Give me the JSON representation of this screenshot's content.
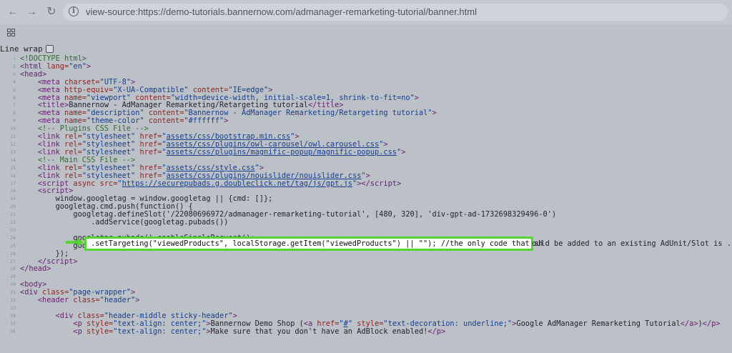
{
  "browser": {
    "url": "view-source:https://demo-tutorials.bannernow.com/admanager-remarketing-tutorial/banner.html",
    "back_icon": "arrow-left-icon",
    "forward_icon": "arrow-right-icon",
    "reload_icon": "reload-icon",
    "info_icon": "info-icon",
    "apps_icon": "grid-icon"
  },
  "viewer": {
    "line_wrap_label": "Line wrap",
    "line_wrap_checked": false
  },
  "source": {
    "lines": [
      {
        "n": "1",
        "html": "<span class=\"cmt\">&lt;!DOCTYPE html&gt;</span>"
      },
      {
        "n": "2",
        "html": "<span class=\"tag\">&lt;html</span> <span class=\"attr\">lang=</span><span class=\"val\">\"en\"</span><span class=\"tag\">&gt;</span>"
      },
      {
        "n": "3",
        "html": "<span class=\"tag\">&lt;head&gt;</span>"
      },
      {
        "n": "4",
        "html": "    <span class=\"tag\">&lt;meta</span> <span class=\"attr\">charset=</span><span class=\"val\">\"UTF-8\"</span><span class=\"tag\">&gt;</span>"
      },
      {
        "n": "5",
        "html": "    <span class=\"tag\">&lt;meta</span> <span class=\"attr\">http-equiv=</span><span class=\"val\">\"X-UA-Compatible\"</span> <span class=\"attr\">content=</span><span class=\"val\">\"IE=edge\"</span><span class=\"tag\">&gt;</span>"
      },
      {
        "n": "6",
        "html": "    <span class=\"tag\">&lt;meta</span> <span class=\"attr\">name=</span><span class=\"val\">\"viewport\"</span> <span class=\"attr\">content=</span><span class=\"val\">\"width=device-width, initial-scale=1, shrink-to-fit=no\"</span><span class=\"tag\">&gt;</span>"
      },
      {
        "n": "7",
        "html": "    <span class=\"tag\">&lt;title&gt;</span>Bannernow - AdManager Remarketing/Retargeting tutorial<span class=\"tag\">&lt;/title&gt;</span>"
      },
      {
        "n": "8",
        "html": "    <span class=\"tag\">&lt;meta</span> <span class=\"attr\">name=</span><span class=\"val\">\"description\"</span> <span class=\"attr\">content=</span><span class=\"val\">\"Bannernow - AdManager Remarketing/Retargeting tutorial\"</span><span class=\"tag\">&gt;</span>"
      },
      {
        "n": "9",
        "html": "    <span class=\"tag\">&lt;meta</span> <span class=\"attr\">name=</span><span class=\"val\">\"theme-color\"</span> <span class=\"attr\">content=</span><span class=\"val\">\"#ffffff\"</span><span class=\"tag\">&gt;</span>"
      },
      {
        "n": "10",
        "html": "    <span class=\"cmt\">&lt;!-- Plugins CSS File --&gt;</span>"
      },
      {
        "n": "11",
        "html": "    <span class=\"tag\">&lt;link</span> <span class=\"attr\">rel=</span><span class=\"val\">\"stylesheet\"</span> <span class=\"attr\">href=</span><span class=\"val\">\"<span class=\"link\">assets/css/bootstrap.min.css</span>\"</span><span class=\"tag\">&gt;</span>"
      },
      {
        "n": "12",
        "html": "    <span class=\"tag\">&lt;link</span> <span class=\"attr\">rel=</span><span class=\"val\">\"stylesheet\"</span> <span class=\"attr\">href=</span><span class=\"val\">\"<span class=\"link\">assets/css/plugins/owl-carousel/owl.carousel.css</span>\"</span><span class=\"tag\">&gt;</span>"
      },
      {
        "n": "13",
        "html": "    <span class=\"tag\">&lt;link</span> <span class=\"attr\">rel=</span><span class=\"val\">\"stylesheet\"</span> <span class=\"attr\">href=</span><span class=\"val\">\"<span class=\"link\">assets/css/plugins/magnific-popup/magnific-popup.css</span>\"</span><span class=\"tag\">&gt;</span>"
      },
      {
        "n": "14",
        "html": "    <span class=\"cmt\">&lt;!-- Main CSS File --&gt;</span>"
      },
      {
        "n": "15",
        "html": "    <span class=\"tag\">&lt;link</span> <span class=\"attr\">rel=</span><span class=\"val\">\"stylesheet\"</span> <span class=\"attr\">href=</span><span class=\"val\">\"<span class=\"link\">assets/css/style.css</span>\"</span><span class=\"tag\">&gt;</span>"
      },
      {
        "n": "16",
        "html": "    <span class=\"tag\">&lt;link</span> <span class=\"attr\">rel=</span><span class=\"val\">\"stylesheet\"</span> <span class=\"attr\">href=</span><span class=\"val\">\"<span class=\"link\">assets/css/plugins/nouislider/nouislider.css</span>\"</span><span class=\"tag\">&gt;</span>"
      },
      {
        "n": "17",
        "html": "    <span class=\"tag\">&lt;script</span> <span class=\"attr\">async src=</span><span class=\"val\">\"<span class=\"link\">https://securepubads.g.doubleclick.net/tag/js/gpt.js</span>\"</span><span class=\"tag\">&gt;&lt;/script&gt;</span>"
      },
      {
        "n": "18",
        "html": "    <span class=\"tag\">&lt;script&gt;</span>"
      },
      {
        "n": "19",
        "html": "        window.googletag = window.googletag || {cmd: []};"
      },
      {
        "n": "20",
        "html": "        googletag.cmd.push(function() {"
      },
      {
        "n": "21",
        "html": "            googletag.defineSlot('/22080696972/admanager-remarketing-tutorial', [480, 320], 'div-gpt-ad-1732698329496-0')"
      },
      {
        "n": "22",
        "html": "                .addService(googletag.pubads())"
      },
      {
        "n": "23",
        "html": ""
      },
      {
        "n": "24",
        "html": "            googletag.pubads().enableSingleRequest();"
      },
      {
        "n": "25",
        "html": "            googletag.enableServices();"
      },
      {
        "n": "26",
        "html": "        });"
      },
      {
        "n": "27",
        "html": "    <span class=\"tag\">&lt;/script&gt;</span>"
      },
      {
        "n": "28",
        "html": "<span class=\"tag\">&lt;/head&gt;</span>"
      },
      {
        "n": "29",
        "html": ""
      },
      {
        "n": "30",
        "html": "<span class=\"tag\">&lt;body&gt;</span>"
      },
      {
        "n": "31",
        "html": "<span class=\"tag\">&lt;div</span> <span class=\"attr\">class=</span><span class=\"val\">\"page-wrapper\"</span><span class=\"tag\">&gt;</span>"
      },
      {
        "n": "32",
        "html": "    <span class=\"tag\">&lt;header</span> <span class=\"attr\">class=</span><span class=\"val\">\"header\"</span><span class=\"tag\">&gt;</span>"
      },
      {
        "n": "33",
        "html": ""
      },
      {
        "n": "34",
        "html": "        <span class=\"tag\">&lt;div</span> <span class=\"attr\">class=</span><span class=\"val\">\"header-middle sticky-header\"</span><span class=\"tag\">&gt;</span>"
      },
      {
        "n": "35",
        "html": "            <span class=\"tag\">&lt;p</span> <span class=\"attr\">style=</span><span class=\"val\">\"text-align: center;\"</span><span class=\"tag\">&gt;</span>Bannernow Demo Shop (<span class=\"tag\">&lt;a</span> <span class=\"attr\">href=</span><span class=\"val\">\"<span class=\"link\">#</span>\"</span> <span class=\"attr\">style=</span><span class=\"val\">\"text-decoration: underline;\"</span><span class=\"tag\">&gt;</span>Google AdManager Remarketing Tutorial<span class=\"tag\">&lt;/a&gt;</span>)<span class=\"tag\">&lt;/p&gt;</span>"
      },
      {
        "n": "36",
        "html": "            <span class=\"tag\">&lt;p</span> <span class=\"attr\">style=</span><span class=\"val\">\"text-align: center;\"</span><span class=\"tag\">&gt;</span>Make sure that you don't have an AdBlock enabled!<span class=\"tag\">&lt;/p&gt;</span>"
      }
    ],
    "highlighted_line": ".setTargeting(\"viewedProducts\", localStorage.getItem(\"viewedProducts\") || \"\"); //the only code that sh",
    "highlighted_line_overflow": "ould be added to an existing AdUnit/Slot is .set",
    "highlight_color": "#56d435"
  }
}
